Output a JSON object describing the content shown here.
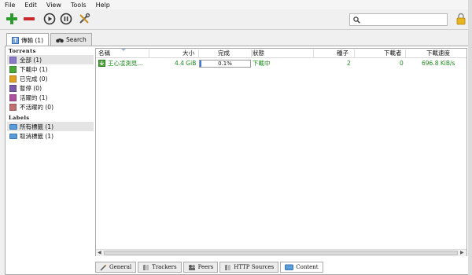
{
  "menu": [
    "File",
    "Edit",
    "View",
    "Tools",
    "Help"
  ],
  "toolbar": {
    "icons": [
      "add-torrent-icon",
      "remove-torrent-icon",
      "start-icon",
      "pause-icon",
      "preferences-icon"
    ],
    "search_placeholder": "",
    "lock": "lock-icon"
  },
  "tabs": [
    {
      "label": "傳輸 (1)",
      "active": true
    },
    {
      "label": "Search",
      "active": false
    }
  ],
  "sidebar": {
    "torrents_title": "Torrents",
    "torrents": [
      {
        "label": "全部 (1)",
        "color": "#8a78c8",
        "selected": true
      },
      {
        "label": "下載中 (1)",
        "color": "#4aa83a",
        "selected": false
      },
      {
        "label": "已完成 (0)",
        "color": "#e0a020",
        "selected": false
      },
      {
        "label": "暫停 (0)",
        "color": "#7a5aa8",
        "selected": false
      },
      {
        "label": "活躍的 (1)",
        "color": "#b050a0",
        "selected": false
      },
      {
        "label": "不活躍的 (0)",
        "color": "#c07070",
        "selected": false
      }
    ],
    "labels_title": "Labels",
    "labels": [
      {
        "label": "所有標籤 (1)",
        "selected": true
      },
      {
        "label": "取消標籤 (1)",
        "selected": false
      }
    ]
  },
  "columns": {
    "name": "名稱",
    "size": "大小",
    "done": "完成",
    "status": "狀態",
    "seeds": "種子",
    "peers": "下載者",
    "down_speed": "下載速度"
  },
  "torrent": {
    "name": "王心凌測見...",
    "size": "4.4 GiB",
    "progress_text": "0.1%",
    "progress_fraction": 0.001,
    "status": "下載中",
    "seeds": "2",
    "peers": "0",
    "down_speed": "696.8 KiB/s"
  },
  "bottom_tabs": [
    {
      "label": "General",
      "icon": "general-icon"
    },
    {
      "label": "Trackers",
      "icon": "trackers-icon"
    },
    {
      "label": "Peers",
      "icon": "peers-icon"
    },
    {
      "label": "HTTP Sources",
      "icon": "http-sources-icon"
    },
    {
      "label": "Content",
      "icon": "content-icon",
      "active": true
    }
  ]
}
